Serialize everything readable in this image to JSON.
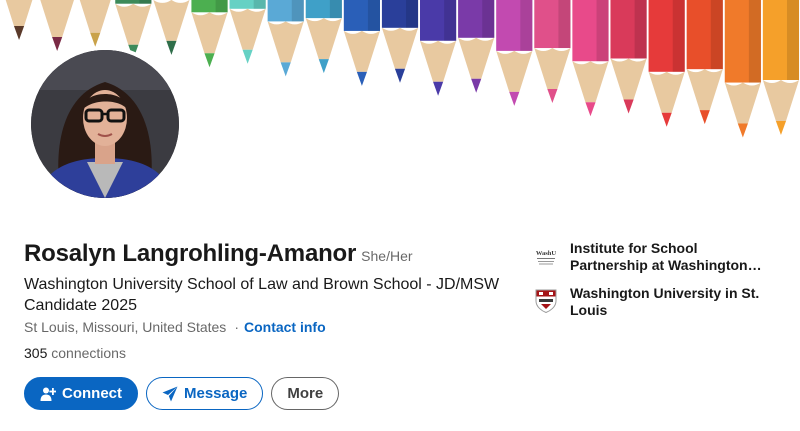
{
  "profile": {
    "name": "Rosalyn Langrohling-Amanor",
    "pronouns": "She/Her",
    "headline": "Washington University School of Law and Brown School - JD/MSW Candidate 2025",
    "location": "St Louis, Missouri, United States",
    "separator": "·",
    "contact_info": "Contact info",
    "connections_count": "305",
    "connections_label": "connections"
  },
  "actions": {
    "connect_label": "Connect",
    "message_label": "Message",
    "more_label": "More"
  },
  "organizations": [
    {
      "name": "Institute for School Partnership at Washington University in S...",
      "logo_text": "WashU",
      "icon": "isp-logo-icon"
    },
    {
      "name": "Washington University in St. Louis",
      "icon": "washu-shield-icon"
    }
  ],
  "banner": {
    "icon": "colored-pencils-banner",
    "pencil_colors": [
      "#5a3a2a",
      "#7a2a45",
      "#c9a24a",
      "#3d8a5a",
      "#2f6e4a",
      "#4caf50",
      "#66d1c4",
      "#5aa9d6",
      "#3fa0c8",
      "#2a5fb8",
      "#2a3f9a",
      "#4a3aa8",
      "#7a3aa8",
      "#c24ab0",
      "#e0508a",
      "#e84a8a",
      "#d93a5a",
      "#e63a3a",
      "#e84f2a",
      "#f07a2a",
      "#f5a02a"
    ]
  },
  "colors": {
    "accent": "#0a66c2",
    "text_primary": "#191919",
    "text_secondary": "#666666"
  }
}
